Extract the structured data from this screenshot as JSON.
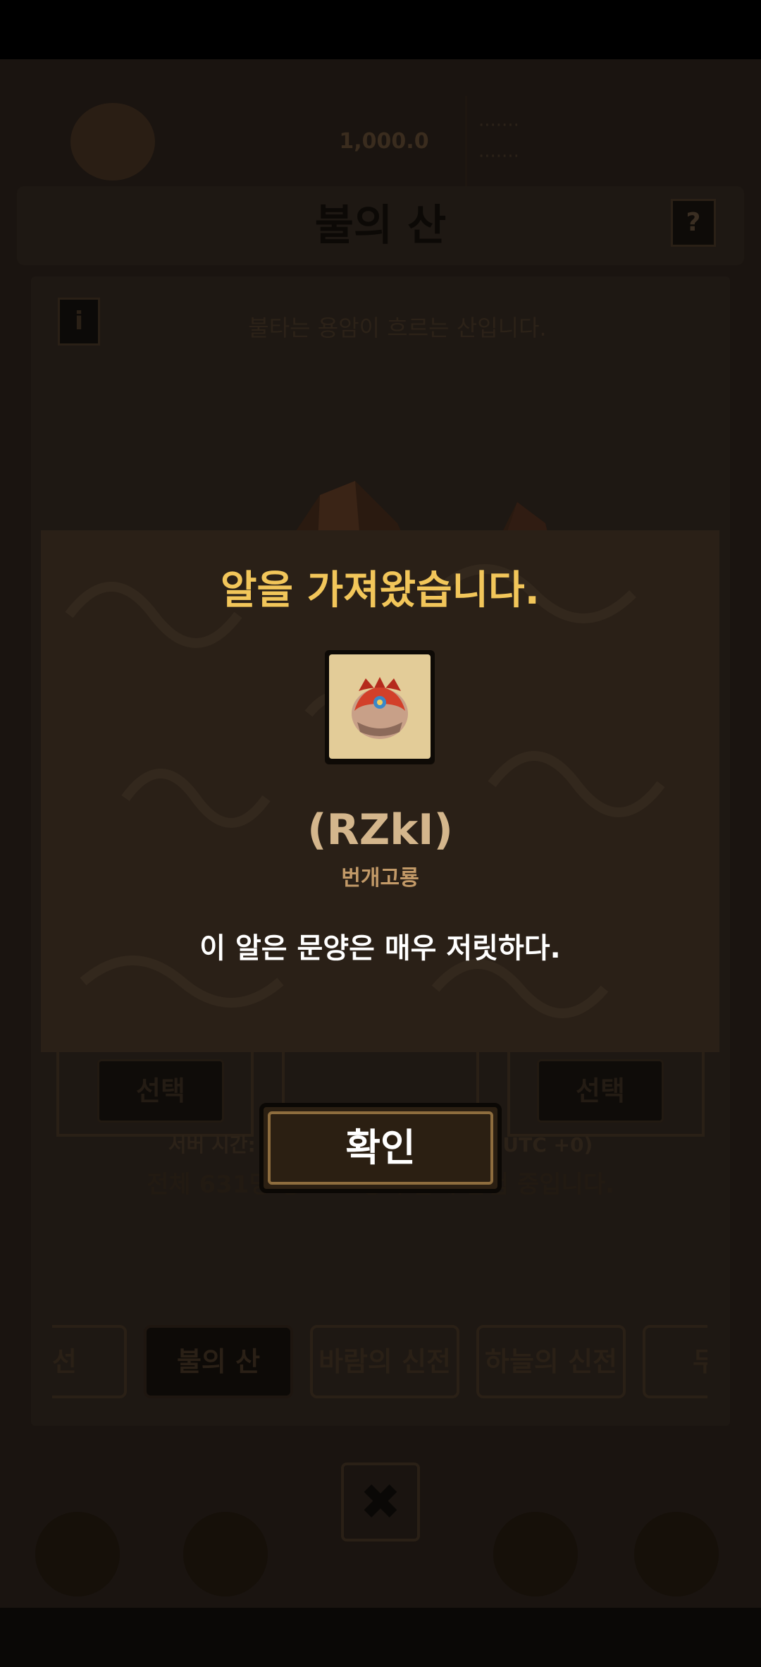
{
  "topbar": {
    "gold_text": "1,000.0",
    "info_line1": "·······",
    "info_line2": "·······"
  },
  "page_title": "불의 산",
  "help_label": "?",
  "info_label": "i",
  "description": "불타는 용암이 흐르는 산입니다.",
  "select_buttons": [
    "선택",
    "선택"
  ],
  "server_time": "서버 시간: 2023-07-18 01:39:12(UTC +0)",
  "user_count": "전체 631명 중 210명이 함께 탐험 중입니다.",
  "tabs": [
    {
      "label": "마선"
    },
    {
      "label": "불의 산"
    },
    {
      "label": "바람의 신전"
    },
    {
      "label": "하늘의 신전"
    },
    {
      "label": "무지"
    }
  ],
  "close_label": "✖",
  "dialog": {
    "title": "알을 가져왔습니다.",
    "egg_name": "(RZkI)",
    "egg_species": "번개고룡",
    "egg_description": "이 알은 문양은 매우 저릿하다.",
    "confirm_label": "확인"
  },
  "colors": {
    "title_gold": "#f2c65a",
    "dialog_bg": "#2a2017",
    "card_bg": "#e3cc98"
  }
}
